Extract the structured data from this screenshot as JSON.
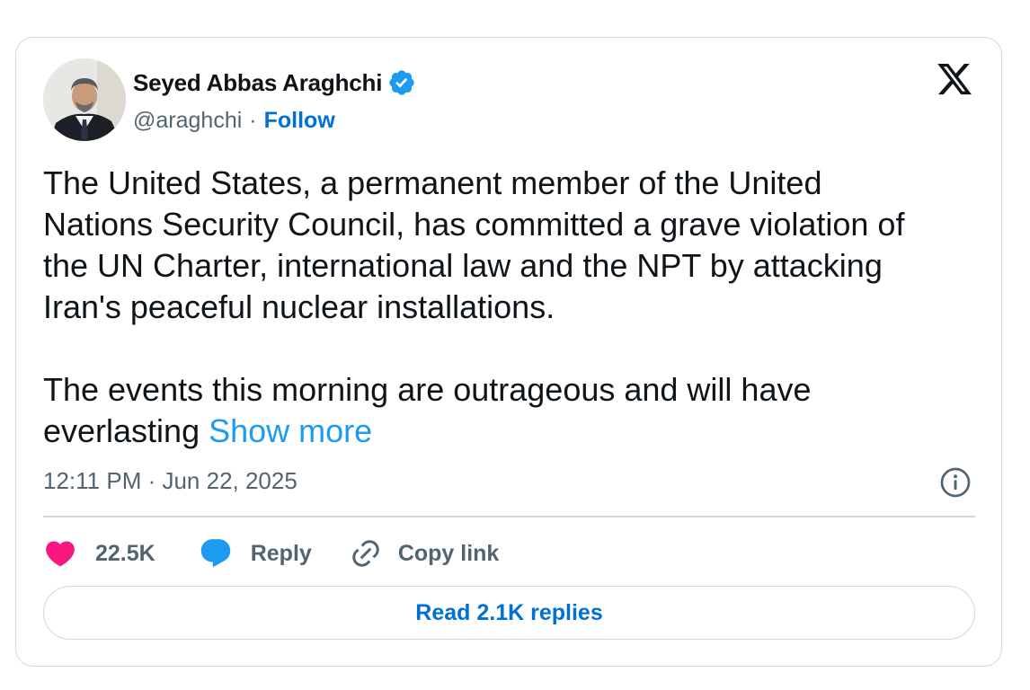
{
  "author": {
    "name": "Seyed Abbas Araghchi",
    "handle": "@araghchi",
    "separator": "·",
    "follow_label": "Follow",
    "verified": true,
    "verified_icon": "verified-badge-icon",
    "verified_color": "#1d9bf0"
  },
  "platform": {
    "logo_icon": "x-logo-icon"
  },
  "tweet": {
    "paragraph1_lines": [
      "The United States, a permanent member of the United",
      "Nations Security Council, has committed a grave violation of",
      "the UN Charter, international law and the NPT by attacking",
      "Iran's peaceful nuclear installations."
    ],
    "paragraph2_line1": "The events this morning are outrageous and will have",
    "paragraph2_line2_prefix": "everlasting ",
    "show_more_label": "Show more",
    "show_more_color": "#1d9bf0"
  },
  "meta": {
    "timestamp": "12:11 PM · Jun 22, 2025",
    "info_icon": "info-icon"
  },
  "actions": {
    "like_count": "22.5K",
    "like_icon": "heart-icon",
    "like_color": "#f91880",
    "reply_label": "Reply",
    "reply_icon": "speech-bubble-icon",
    "reply_color": "#1d9bf0",
    "copy_link_label": "Copy link",
    "copy_link_icon": "link-icon"
  },
  "replies_button_label": "Read 2.1K replies",
  "colors": {
    "text_primary": "#0f1419",
    "text_secondary": "#536471",
    "link_blue": "#006fd6",
    "border": "#cfd9de"
  }
}
